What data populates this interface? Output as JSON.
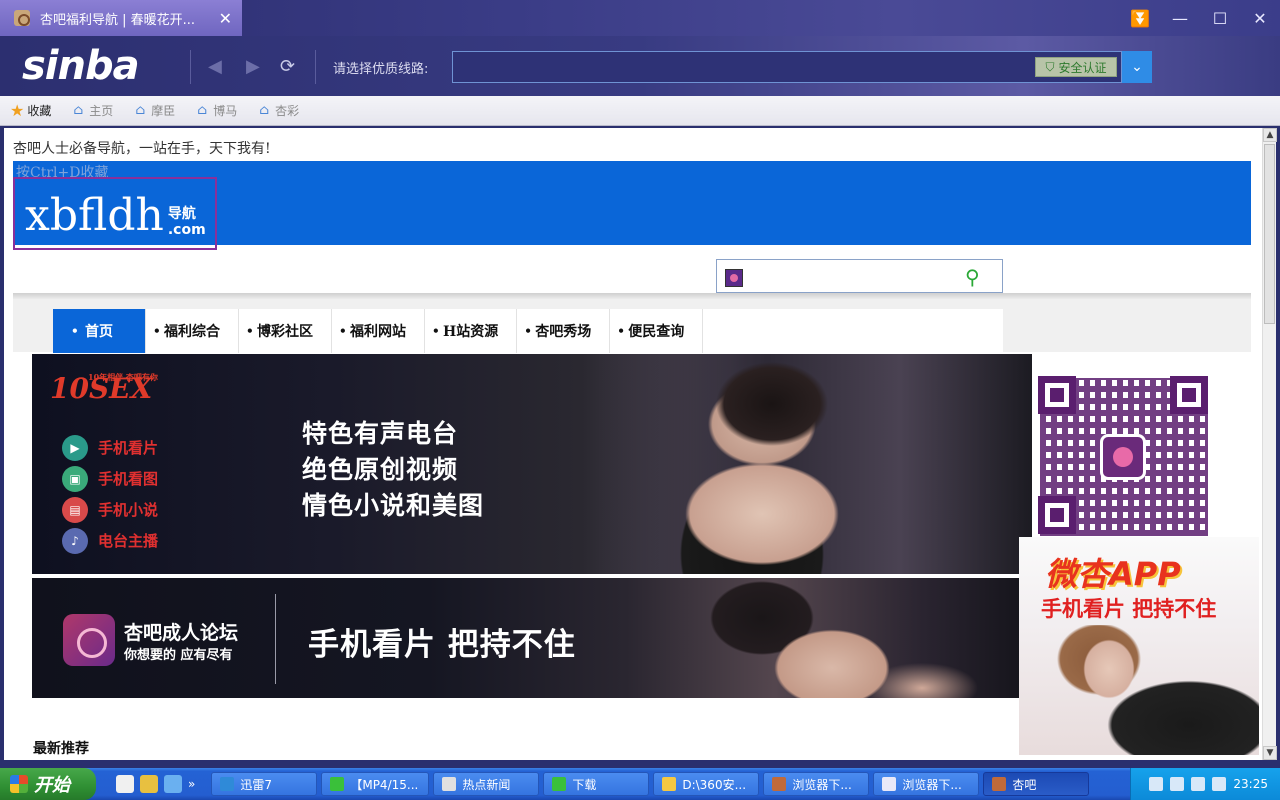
{
  "browser": {
    "tab_title": "杏吧福利导航  |  春暖花开...",
    "tab_close": "✕",
    "window_controls": {
      "tab_list": "⏬",
      "minimize": "—",
      "maximize": "☐",
      "close": "✕"
    },
    "logo_text": "sinba",
    "nav": {
      "back": "◀",
      "forward": "▶",
      "refresh": "⟳"
    },
    "line_label": "请选择优质线路:",
    "address_value": "",
    "security_badge": "安全认证",
    "dropdown_arrow": "⌄"
  },
  "bookmarks": {
    "favorites_label": "收藏",
    "items": [
      "主页",
      "摩臣",
      "博马",
      "杏彩"
    ]
  },
  "page": {
    "tagline": "杏吧人士必备导航，一站在手，天下我有!",
    "ctrl_d_hint": "按Ctrl+D收藏",
    "site_logo": {
      "main": "xbfldh",
      "side_top": "导航",
      "side_bottom": ".com"
    },
    "search_placeholder": "",
    "search_icon": "search-icon",
    "menu": [
      "首页",
      "福利综合",
      "博彩社区",
      "福利网站",
      "H站资源",
      "杏吧秀场",
      "便民查询"
    ],
    "banner1": {
      "logo": "10SEX",
      "logo_small": "10年相伴 杏吧有你",
      "features": [
        "手机看片",
        "手机看图",
        "手机小说",
        "电台主播"
      ],
      "feature_colors": [
        "#2a9a8a",
        "#3aaa7a",
        "#d84a4a",
        "#5a6ab0"
      ],
      "slogans": [
        "特色有声电台",
        "绝色原创视频",
        "情色小说和美图"
      ]
    },
    "banner2": {
      "title": "杏吧成人论坛",
      "subtitle": "你想要的 应有尽有",
      "slogan": "手机看片 把持不住"
    },
    "app_ad": {
      "title": "微杏APP",
      "subtitle": "手机看片 把持不住"
    },
    "latest_heading": "最新推荐"
  },
  "taskbar": {
    "start_label": "开始",
    "quick_launch_colors": [
      "#f0f0f0",
      "#e8c040",
      "#6ab0f0"
    ],
    "overflow": "»",
    "tasks": [
      {
        "label": "迅雷7",
        "color": "#2f8ad8"
      },
      {
        "label": "【MP4/15...",
        "color": "#3ac03a"
      },
      {
        "label": "热点新闻",
        "color": "#e0e0e0"
      },
      {
        "label": "下载",
        "color": "#3ac03a"
      },
      {
        "label": "D:\\360安...",
        "color": "#f5c842"
      },
      {
        "label": "浏览器下...",
        "color": "#c06a3a"
      },
      {
        "label": "浏览器下...",
        "color": "#e8e8f8"
      },
      {
        "label": "杏吧",
        "color": "#c06a3a"
      }
    ],
    "clock": "23:25"
  }
}
